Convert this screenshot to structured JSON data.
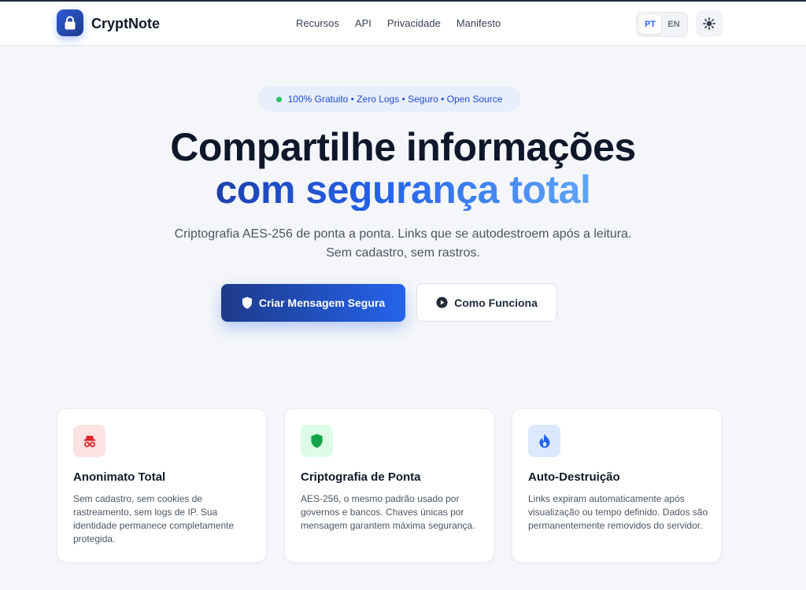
{
  "header": {
    "brand": "CryptNote",
    "nav": [
      "Recursos",
      "API",
      "Privacidade",
      "Manifesto"
    ],
    "languages": [
      "PT",
      "EN"
    ],
    "active_language": "PT"
  },
  "hero": {
    "badge": "100% Gratuito • Zero Logs • Seguro • Open Source",
    "title_line1": "Compartilhe informações",
    "title_line2": "com segurança total",
    "subtitle": "Criptografia AES-256 de ponta a ponta. Links que se autodestroem após a leitura. Sem cadastro, sem rastros.",
    "primary_button": "Criar Mensagem Segura",
    "secondary_button": "Como Funciona"
  },
  "features": [
    {
      "title": "Anonimato Total",
      "description": "Sem cadastro, sem cookies de rastreamento, sem logs de IP. Sua identidade permanece completamente protegida.",
      "icon": "incognito-icon",
      "color": "#dc2626",
      "bg": "#fde2e2"
    },
    {
      "title": "Criptografia de Ponta",
      "description": "AES-256, o mesmo padrão usado por governos e bancos. Chaves únicas por mensagem garantem máxima segurança.",
      "icon": "shield-icon",
      "color": "#16a34a",
      "bg": "#dcfce7"
    },
    {
      "title": "Auto-Destruição",
      "description": "Links expiram automaticamente após visualização ou tempo definido. Dados são permanentemente removidos do servidor.",
      "icon": "fire-icon",
      "color": "#2563eb",
      "bg": "#dbe8fe"
    }
  ],
  "colors": {
    "accent": "#2563eb",
    "accent_dark": "#1e3a8a",
    "status_dot": "#22c55e"
  }
}
